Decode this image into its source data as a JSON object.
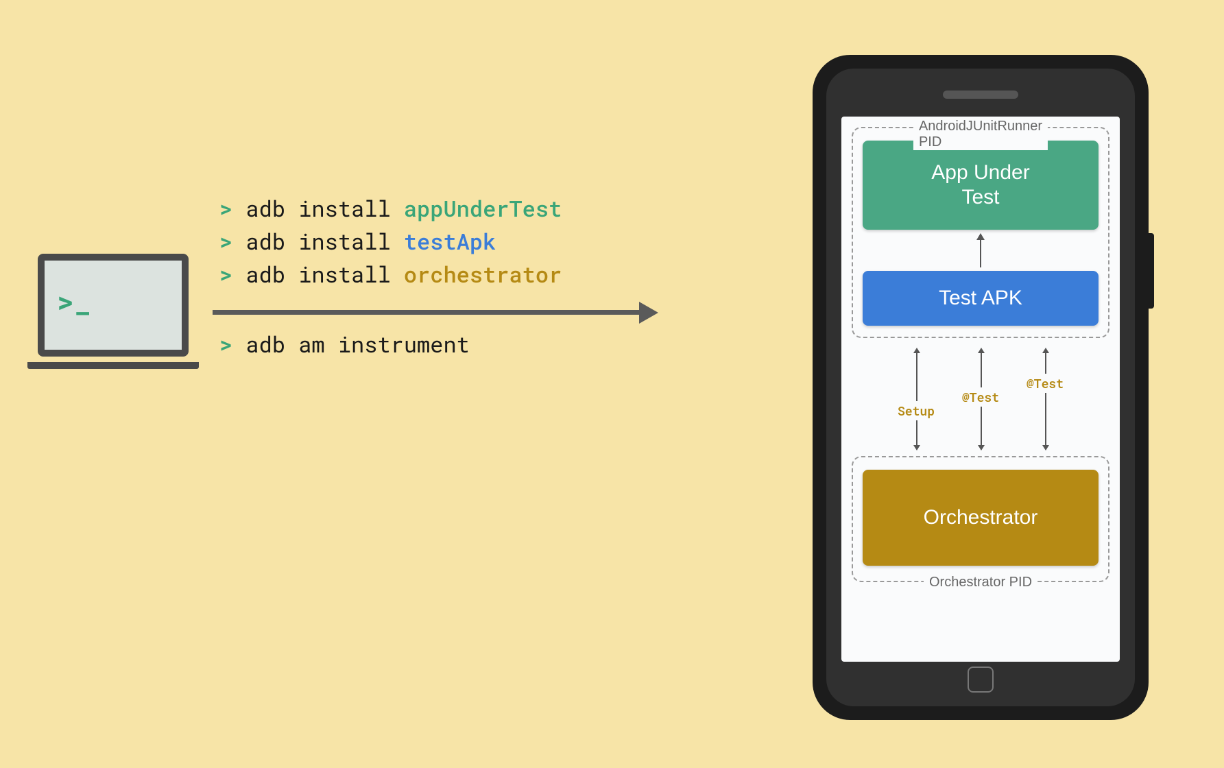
{
  "laptop": {
    "prompt_glyph": ">_"
  },
  "commands": {
    "pre": [
      {
        "prompt": ">",
        "base": "adb install ",
        "arg": "appUnderTest",
        "arg_class": "arg-green"
      },
      {
        "prompt": ">",
        "base": "adb install ",
        "arg": "testApk",
        "arg_class": "arg-blue"
      },
      {
        "prompt": ">",
        "base": "adb install ",
        "arg": "orchestrator",
        "arg_class": "arg-gold"
      }
    ],
    "post": {
      "prompt": ">",
      "base": "adb am instrument"
    }
  },
  "phone": {
    "top_group_label": "AndroidJUnitRunner PID",
    "bottom_group_label": "Orchestrator PID",
    "blocks": {
      "app_under_test": "App Under\nTest",
      "test_apk": "Test APK",
      "orchestrator": "Orchestrator"
    },
    "connector_labels": {
      "setup": "Setup",
      "test1": "@Test",
      "test2": "@Test"
    }
  },
  "colors": {
    "green": "#4aa784",
    "blue": "#3b7dd8",
    "gold": "#b58a14",
    "bg": "#f7e4a7"
  }
}
